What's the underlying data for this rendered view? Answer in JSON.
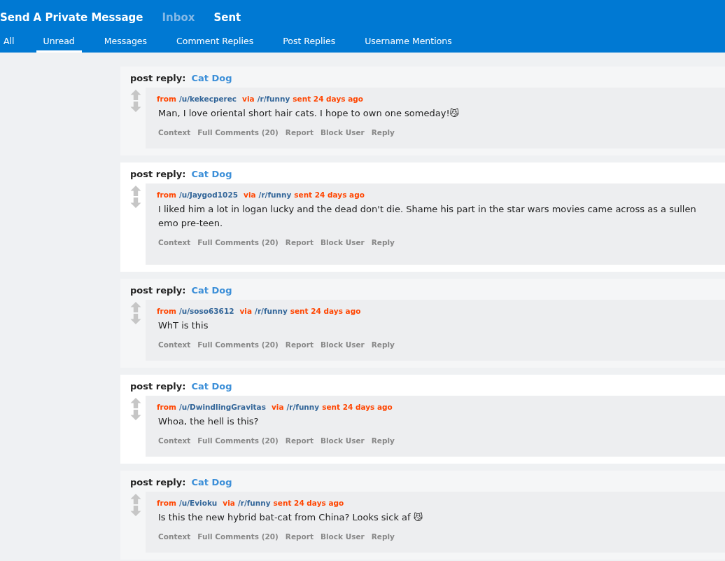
{
  "header": {
    "links": [
      {
        "label": "Send A Private Message",
        "selected": false
      },
      {
        "label": "Inbox",
        "selected": true
      },
      {
        "label": "Sent",
        "selected": false
      }
    ]
  },
  "tabs": [
    {
      "label": "All",
      "selected": false
    },
    {
      "label": "Unread",
      "selected": true
    },
    {
      "label": "Messages",
      "selected": false
    },
    {
      "label": "Comment Replies",
      "selected": false
    },
    {
      "label": "Post Replies",
      "selected": false
    },
    {
      "label": "Username Mentions",
      "selected": false
    }
  ],
  "messages": [
    {
      "kind_label": "post reply:",
      "post_title": "Cat Dog",
      "from": "from",
      "user": "/u/kekecperec",
      "via": "via",
      "subreddit": "/r/funny",
      "sent": "sent 24 days ago",
      "body": "Man, I love oriental short hair cats. I hope to own one someday!😼",
      "actions": [
        "Context",
        "Full Comments (20)",
        "Report",
        "Block User",
        "Reply"
      ]
    },
    {
      "kind_label": "post reply:",
      "post_title": "Cat Dog",
      "from": "from",
      "user": "/u/Jaygod1025",
      "via": "via",
      "subreddit": "/r/funny",
      "sent": "sent 24 days ago",
      "body": "I liked him a lot in logan lucky and the dead don't die. Shame his part in the star wars movies came across as a sullen emo pre-teen.",
      "actions": [
        "Context",
        "Full Comments (20)",
        "Report",
        "Block User",
        "Reply"
      ]
    },
    {
      "kind_label": "post reply:",
      "post_title": "Cat Dog",
      "from": "from",
      "user": "/u/soso63612",
      "via": "via",
      "subreddit": "/r/funny",
      "sent": "sent 24 days ago",
      "body": "WhT is this",
      "actions": [
        "Context",
        "Full Comments (20)",
        "Report",
        "Block User",
        "Reply"
      ]
    },
    {
      "kind_label": "post reply:",
      "post_title": "Cat Dog",
      "from": "from",
      "user": "/u/DwindlingGravitas",
      "via": "via",
      "subreddit": "/r/funny",
      "sent": "sent 24 days ago",
      "body": "Whoa, the hell is this?",
      "actions": [
        "Context",
        "Full Comments (20)",
        "Report",
        "Block User",
        "Reply"
      ]
    },
    {
      "kind_label": "post reply:",
      "post_title": "Cat Dog",
      "from": "from",
      "user": "/u/Evioku",
      "via": "via",
      "subreddit": "/r/funny",
      "sent": "sent 24 days ago",
      "body": "Is this the new hybrid bat-cat from China? Looks sick af 😼",
      "actions": [
        "Context",
        "Full Comments (20)",
        "Report",
        "Block User",
        "Reply"
      ]
    }
  ]
}
